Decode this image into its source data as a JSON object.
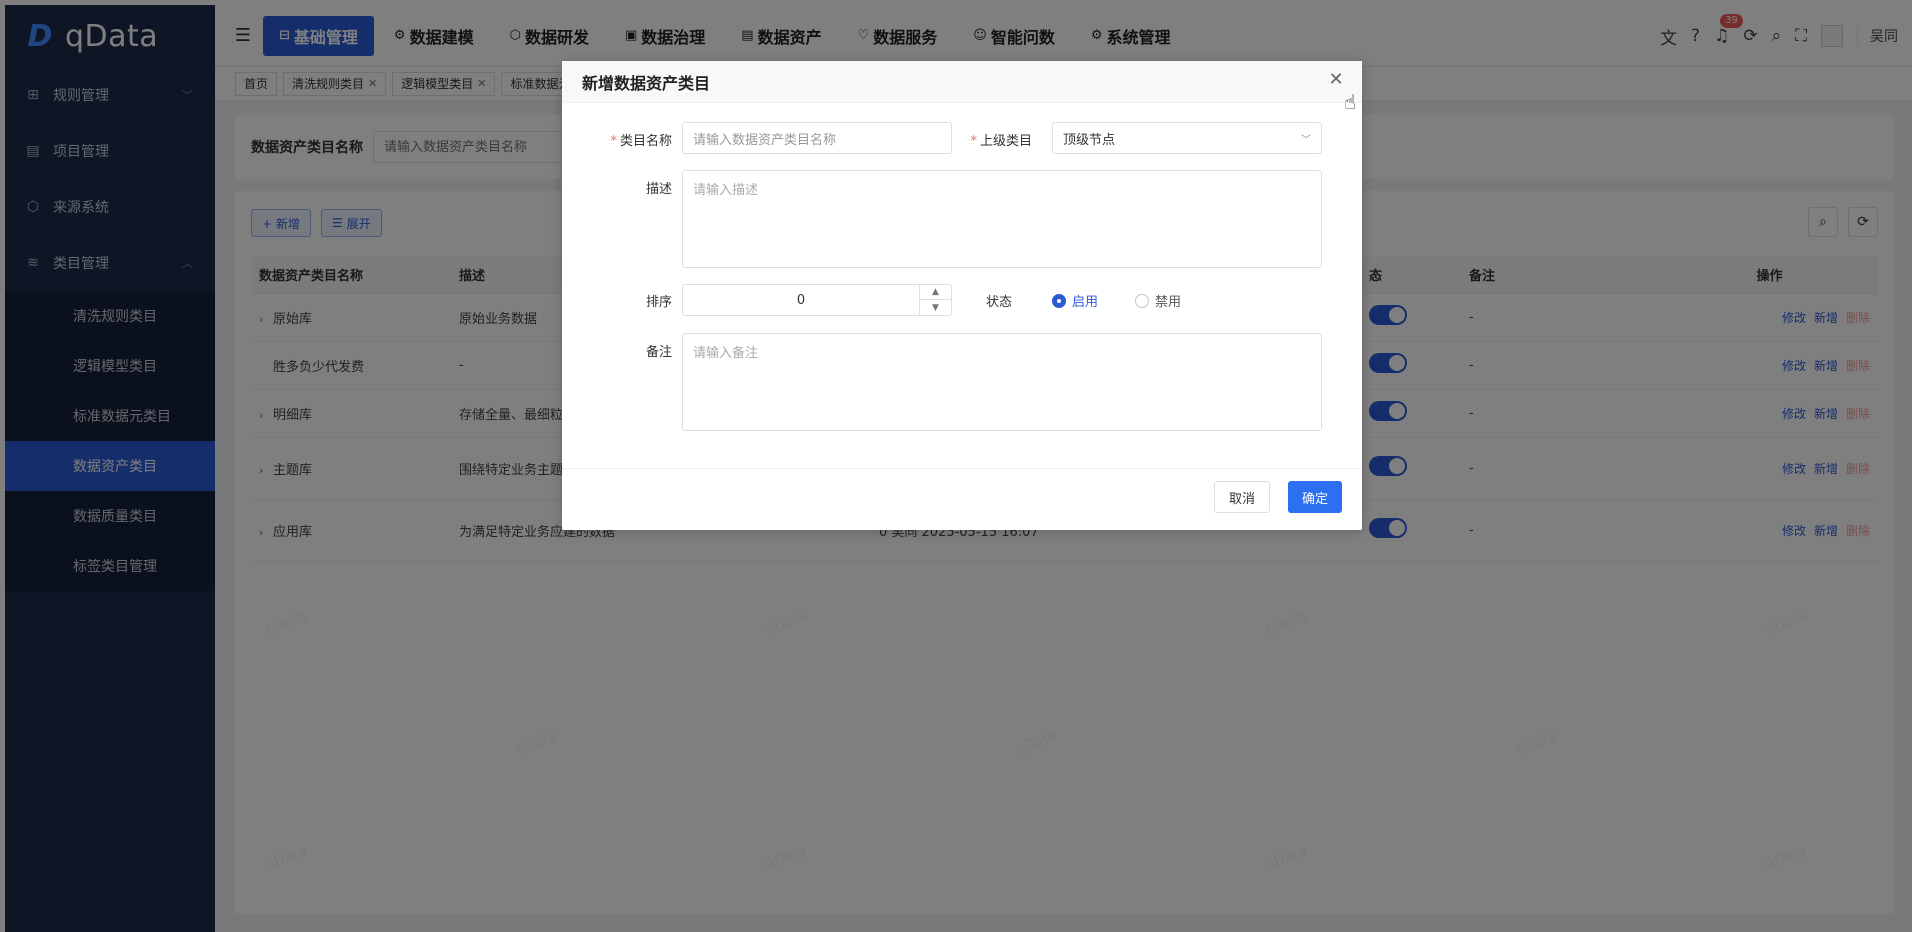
{
  "app": {
    "logo_text": "qData",
    "logo_mark": "D",
    "watermark": "qData",
    "username": "吴同",
    "notification_count": "39"
  },
  "topnav": [
    {
      "label": "基础管理",
      "icon": "grid-icon",
      "glyph": "⊟"
    },
    {
      "label": "数据建模",
      "icon": "cube-icon",
      "glyph": "⚙"
    },
    {
      "label": "数据研发",
      "icon": "hexagon-icon",
      "glyph": "⬡"
    },
    {
      "label": "数据治理",
      "icon": "shield-icon",
      "glyph": "▣"
    },
    {
      "label": "数据资产",
      "icon": "chart-icon",
      "glyph": "▤"
    },
    {
      "label": "数据服务",
      "icon": "heart-icon",
      "glyph": "♡"
    },
    {
      "label": "智能问数",
      "icon": "robot-icon",
      "glyph": "☺"
    },
    {
      "label": "系统管理",
      "icon": "settings-icon",
      "glyph": "⚙"
    }
  ],
  "sidebar": {
    "items": [
      {
        "label": "规则管理",
        "icon": "table-icon",
        "glyph": "⊞",
        "chevron": "﹀"
      },
      {
        "label": "项目管理",
        "icon": "file-icon",
        "glyph": "▤",
        "chevron": ""
      },
      {
        "label": "来源系统",
        "icon": "box-icon",
        "glyph": "⬡",
        "chevron": ""
      },
      {
        "label": "类目管理",
        "icon": "layers-icon",
        "glyph": "≋",
        "chevron": "︿"
      }
    ],
    "sub_items": [
      {
        "label": "清洗规则类目"
      },
      {
        "label": "逻辑模型类目"
      },
      {
        "label": "标准数据元类目"
      },
      {
        "label": "数据资产类目"
      },
      {
        "label": "数据质量类目"
      },
      {
        "label": "标签类目管理"
      }
    ]
  },
  "tabs": [
    {
      "label": "首页",
      "closable": false
    },
    {
      "label": "清洗规则类目",
      "closable": true
    },
    {
      "label": "逻辑模型类目",
      "closable": true
    },
    {
      "label": "标准数据元",
      "closable": false
    }
  ],
  "search": {
    "label": "数据资产类目名称",
    "placeholder": "请输入数据资产类目名称"
  },
  "toolbar": {
    "add_label": "+ 新增",
    "expand_label": "展开"
  },
  "table": {
    "columns": [
      "数据资产类目名称",
      "描述",
      "态",
      "备注",
      "操作"
    ],
    "rows": [
      {
        "name": "原始库",
        "expandable": true,
        "desc": "原始业务数据",
        "remark": "-",
        "extra": ""
      },
      {
        "name": "胜多负少代发费",
        "expandable": false,
        "desc": "-",
        "remark": "-",
        "extra": ""
      },
      {
        "name": "明细库",
        "expandable": true,
        "desc": "存储全量、最细粒",
        "remark": "-",
        "extra": ""
      },
      {
        "name": "主题库",
        "expandable": true,
        "desc": "围绕特定业务主题数据",
        "remark": "-",
        "extra": ""
      },
      {
        "name": "应用库",
        "expandable": true,
        "desc": "为满足特定业务应建的数据",
        "remark": "-",
        "extra": "0   吴同   2025-05-15 16:07"
      }
    ],
    "ops": {
      "edit": "修改",
      "add": "新增",
      "delete": "删除"
    }
  },
  "dialog": {
    "title": "新增数据资产类目",
    "fields": {
      "name_label": "类目名称",
      "name_placeholder": "请输入数据资产类目名称",
      "parent_label": "上级类目",
      "parent_value": "顶级节点",
      "desc_label": "描述",
      "desc_placeholder": "请输入描述",
      "sort_label": "排序",
      "sort_value": "0",
      "status_label": "状态",
      "status_on": "启用",
      "status_off": "禁用",
      "remark_label": "备注",
      "remark_placeholder": "请输入备注"
    },
    "cancel_label": "取消",
    "confirm_label": "确定"
  }
}
